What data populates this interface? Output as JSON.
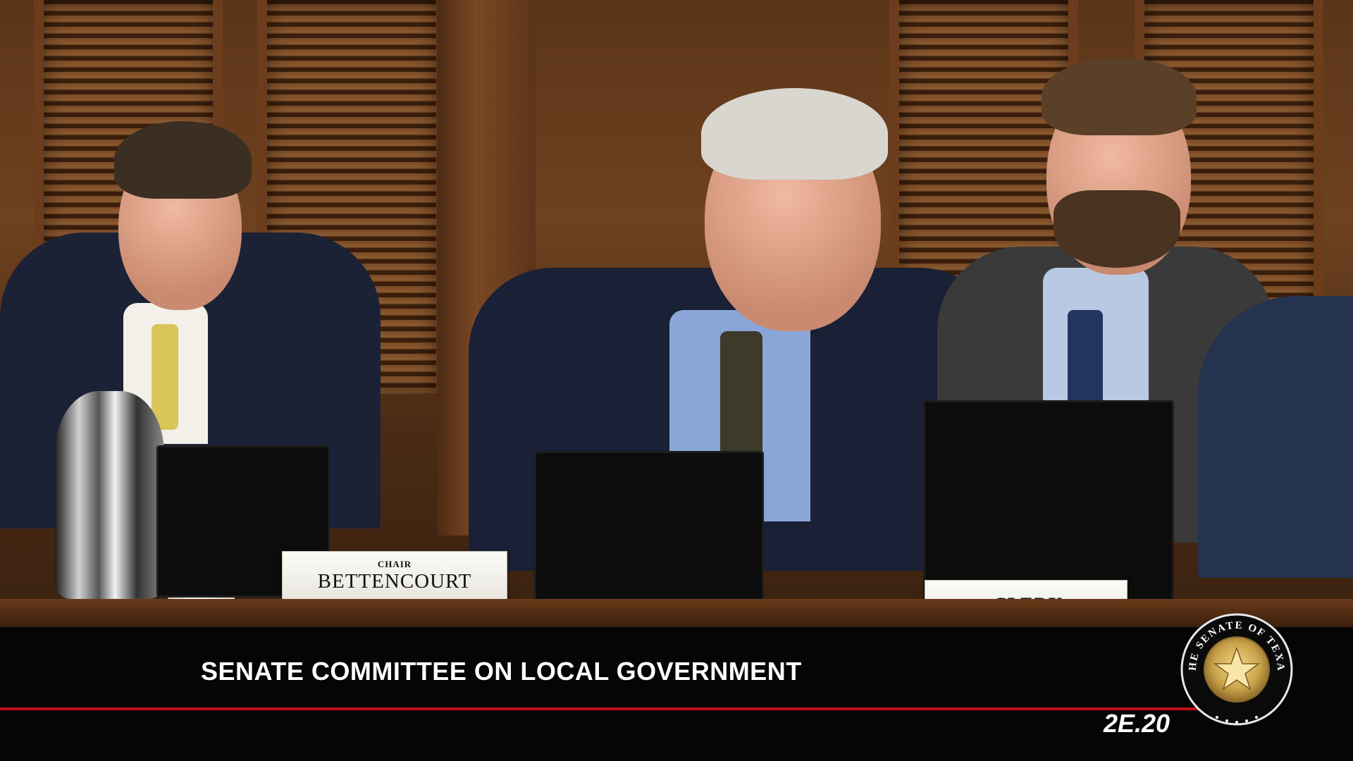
{
  "video": {
    "chyron_title": "SENATE COMMITTEE ON LOCAL GOVERNMENT",
    "bill_number": "2E.20"
  },
  "nameplates": {
    "chair_role": "CHAIR",
    "chair_name": "BETTENCOURT",
    "clerk": "CLERK"
  },
  "seal": {
    "text": "THE SENATE OF TEXAS"
  },
  "colors": {
    "accent_red": "#c0121b",
    "chyron_bg": "#050505",
    "seal_gold": "#c9a24a"
  }
}
